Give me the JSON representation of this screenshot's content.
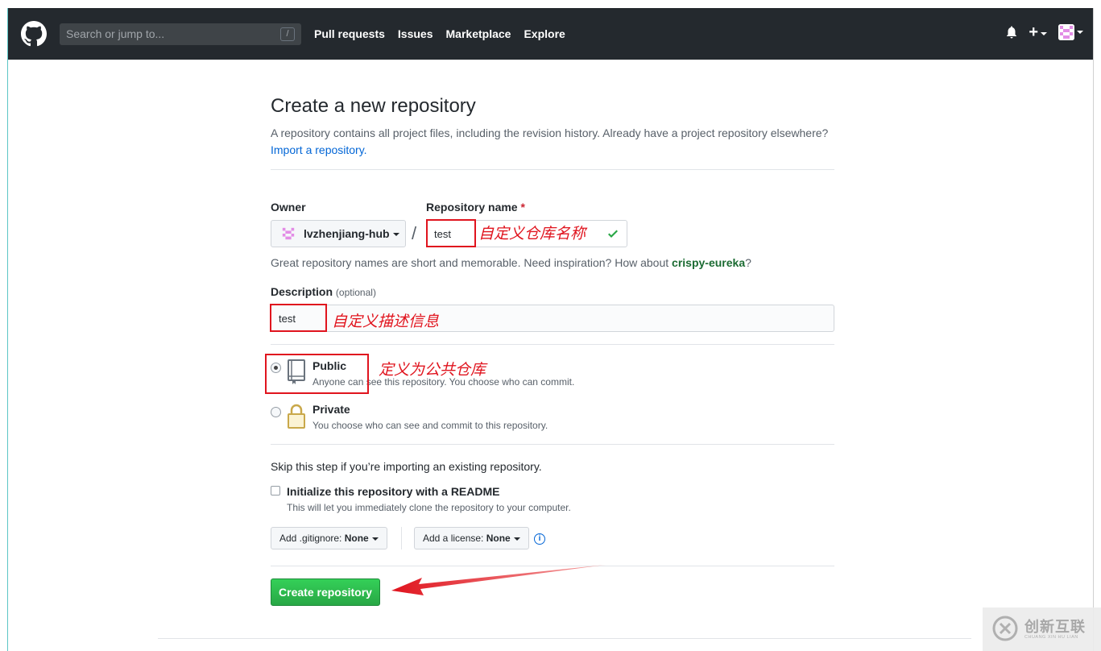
{
  "header": {
    "search_placeholder": "Search or jump to...",
    "search_hotkey": "/",
    "nav": [
      "Pull requests",
      "Issues",
      "Marketplace",
      "Explore"
    ],
    "bg_color": "#24292e"
  },
  "page": {
    "title": "Create a new repository",
    "subtitle": "A repository contains all project files, including the revision history. Already have a project repository elsewhere?",
    "import_link": "Import a repository."
  },
  "form": {
    "owner_label": "Owner",
    "owner_value": "lvzhenjiang-hub",
    "slash": "/",
    "repo_label": "Repository name",
    "repo_required": "*",
    "repo_value": "test",
    "hint_prefix": "Great repository names are short and memorable. Need inspiration? How about ",
    "hint_suggestion": "crispy-eureka",
    "hint_suffix": "?",
    "desc_label": "Description",
    "desc_optional": "(optional)",
    "desc_value": "test",
    "visibility": {
      "public_title": "Public",
      "public_note": "Anyone can see this repository. You choose who can commit.",
      "private_title": "Private",
      "private_note": "You choose who can see and commit to this repository.",
      "selected": "public"
    },
    "skip_text": "Skip this step if you’re importing an existing repository.",
    "readme_label": "Initialize this repository with a README",
    "readme_note": "This will let you immediately clone the repository to your computer.",
    "gitignore_prefix": "Add .gitignore: ",
    "gitignore_value": "None",
    "license_prefix": "Add a license: ",
    "license_value": "None",
    "info_glyph": "i",
    "create_button": "Create repository",
    "create_color": "#2cbe4e"
  },
  "annotations": {
    "repo_name_note": "自定义仓库名称",
    "desc_note": "自定义描述信息",
    "public_note": "定义为公共仓库",
    "color": "#e0141e"
  },
  "watermark": {
    "text": "创新互联",
    "sub": "CHUANG XIN HU LIAN"
  }
}
